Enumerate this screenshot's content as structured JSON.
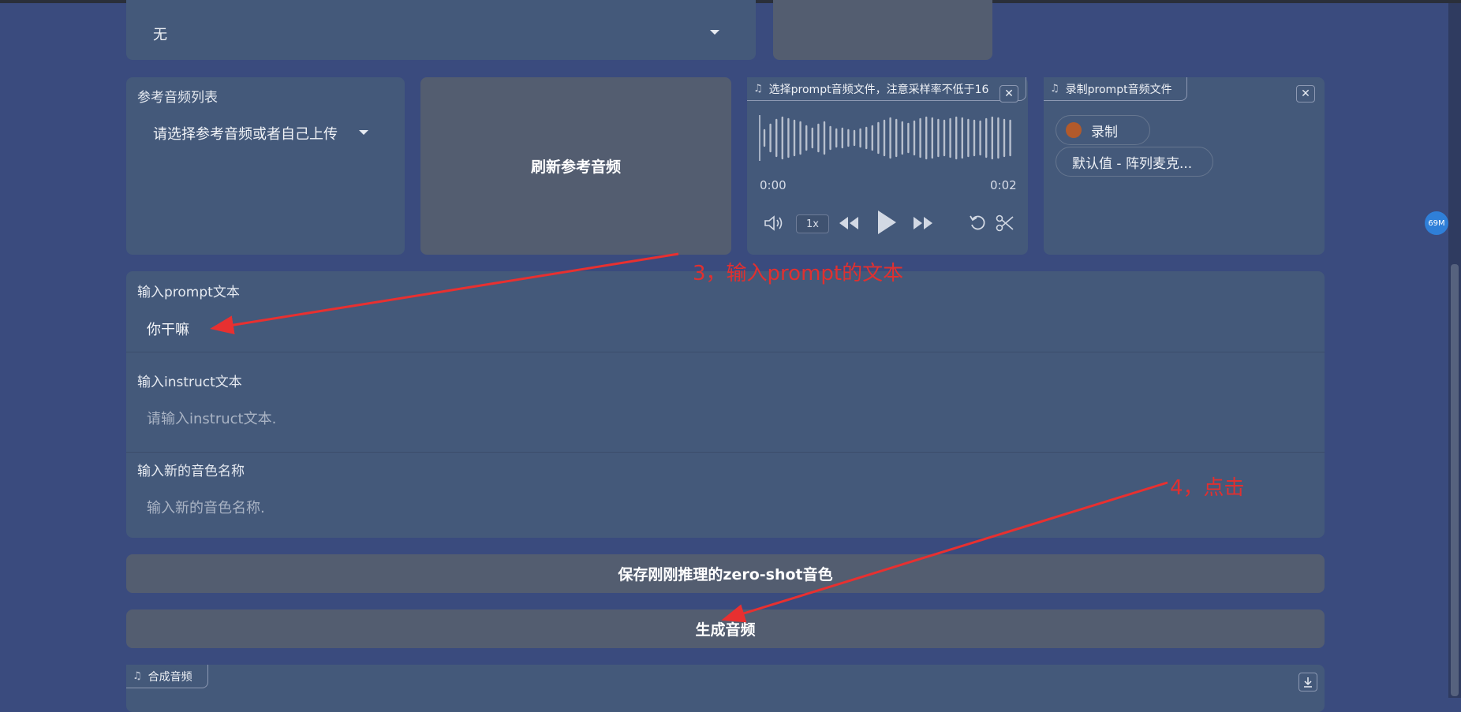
{
  "voice_select": {
    "value": "无"
  },
  "ref_audio": {
    "label": "参考音频列表",
    "value": "请选择参考音频或者自己上传",
    "refresh_label": "刷新参考音频"
  },
  "prompt_upload": {
    "tab_label": "选择prompt音频文件，注意采样率不低于16",
    "time_start": "0:00",
    "time_end": "0:02",
    "speed": "1x"
  },
  "prompt_record": {
    "tab_label": "录制prompt音频文件",
    "record_label": "录制",
    "mic_label": "默认值 - 阵列麦克..."
  },
  "prompt_text": {
    "label": "输入prompt文本",
    "value": "你干嘛"
  },
  "instruct_text": {
    "label": "输入instruct文本",
    "placeholder": "请输入instruct文本."
  },
  "voice_name": {
    "label": "输入新的音色名称",
    "placeholder": "输入新的音色名称."
  },
  "buttons": {
    "save_voice": "保存刚刚推理的zero-shot音色",
    "generate": "生成音频"
  },
  "output": {
    "tab_label": "合成音频"
  },
  "annotations": {
    "step3": "3，输入prompt的文本",
    "step4": "4，点击"
  },
  "memory_badge": "69M",
  "icons": {
    "close": "close-icon",
    "music": "music-note-icon",
    "volume": "volume-icon",
    "rewind": "rewind-icon",
    "play": "play-icon",
    "forward": "fast-forward-icon",
    "reset": "reset-icon",
    "trim": "scissors-icon",
    "download": "download-icon"
  },
  "colors": {
    "background": "#3a4b7e",
    "panel": "#44597a",
    "button": "#535d70",
    "annotation": "#e03030",
    "record_dot": "#b25a2b"
  }
}
